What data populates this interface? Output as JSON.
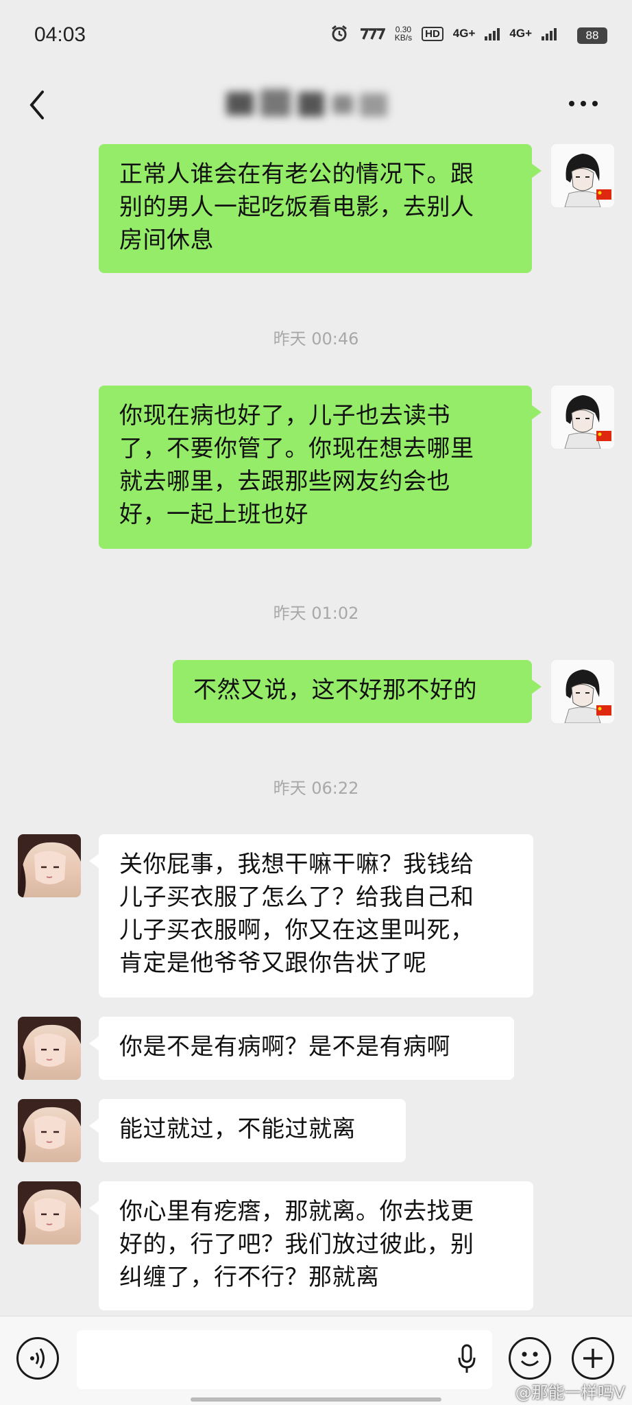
{
  "status_bar": {
    "time": "04:03",
    "net_speed_value": "0.30",
    "net_speed_unit": "KB/s",
    "hd_label": "HD",
    "network_1": "4G+",
    "network_2": "4G+",
    "battery": "88"
  },
  "nav": {
    "title_hidden": true
  },
  "messages": [
    {
      "type": "out",
      "text_lines": [
        "正常人谁会在有老公的情况下。跟",
        "别的男人一起吃饭看电影，去别人",
        "房间休息"
      ]
    },
    {
      "type": "time",
      "text": "昨天 00:46"
    },
    {
      "type": "out",
      "text_lines": [
        "你现在病也好了，儿子也去读书",
        "了，不要你管了。你现在想去哪里",
        "就去哪里，去跟那些网友约会也",
        "好，一起上班也好"
      ]
    },
    {
      "type": "time",
      "text": "昨天 01:02"
    },
    {
      "type": "out",
      "text_lines": [
        "不然又说，这不好那不好的"
      ]
    },
    {
      "type": "time",
      "text": "昨天 06:22"
    },
    {
      "type": "in",
      "text_lines": [
        "关你屁事，我想干嘛干嘛？我钱给",
        "儿子买衣服了怎么了？给我自己和",
        "儿子买衣服啊，你又在这里叫死，",
        "肯定是他爷爷又跟你告状了呢"
      ]
    },
    {
      "type": "in",
      "text_lines": [
        "你是不是有病啊？是不是有病啊"
      ]
    },
    {
      "type": "in",
      "text_lines": [
        "能过就过，不能过就离"
      ]
    },
    {
      "type": "in",
      "text_lines": [
        "你心里有疙瘩，那就离。你去找更",
        "好的，行了吧？我们放过彼此，别",
        "纠缠了，行不行？那就离"
      ]
    }
  ],
  "watermark": "@那能一样吗V",
  "colors": {
    "background": "#ededed",
    "outgoing_bubble": "#95ec69",
    "incoming_bubble": "#ffffff",
    "timestamp": "#a8a8a8"
  },
  "icons": [
    "back-icon",
    "more-icon",
    "voice-icon",
    "mic-icon",
    "emoji-icon",
    "plus-icon"
  ]
}
